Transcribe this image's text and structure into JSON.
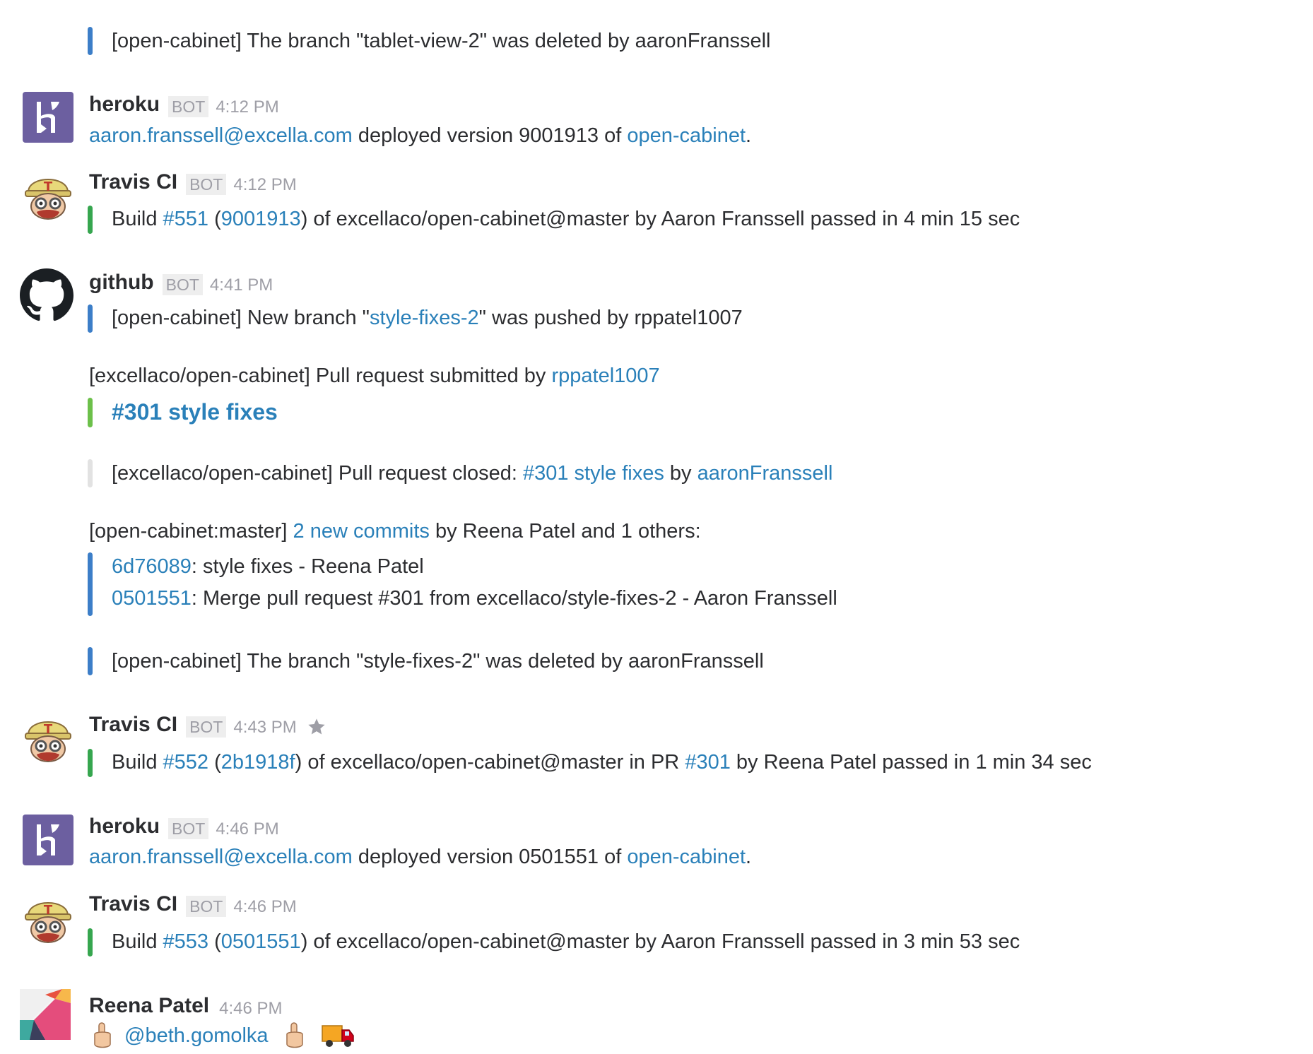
{
  "colors": {
    "link": "#2a80b9",
    "bar_blue": "#3c7ec8",
    "bar_green": "#36a64f",
    "bar_light_green": "#6cc04a",
    "bar_gray": "#e2e2e2",
    "heroku_purple": "#6c5fa0",
    "bot_badge_bg": "#eeeeee",
    "timestamp": "#9e9ea6"
  },
  "messages": [
    {
      "id": "m0",
      "attachment": {
        "prefix": "[open-cabinet] The branch \"tablet-view-2\" was deleted by aaronFranssell"
      }
    },
    {
      "id": "m1",
      "author": "heroku",
      "badge": "BOT",
      "time": "4:12 PM",
      "avatar_icon": "heroku-logo-icon",
      "email": "aaron.franssell@excella.com",
      "mid": " deployed version 9001913 of ",
      "app": "open-cabinet",
      "end": "."
    },
    {
      "id": "m2",
      "author": "Travis CI",
      "badge": "BOT",
      "time": "4:12 PM",
      "avatar_icon": "travis-mascot-icon",
      "t1": "Build ",
      "build": "#551",
      "t2": " (",
      "commit": "9001913",
      "t3": ") of excellaco/open-cabinet@master by Aaron Franssell passed in 4 min 15 sec"
    },
    {
      "id": "m3",
      "author": "github",
      "badge": "BOT",
      "time": "4:41 PM",
      "avatar_icon": "github-octocat-icon",
      "branch_pre": "[open-cabinet] New branch \"",
      "branch": "style-fixes-2",
      "branch_post": "\" was pushed by rppatel1007",
      "pr_pre": "[excellaco/open-cabinet] Pull request submitted by ",
      "pr_user": "rppatel1007",
      "pr_title": "#301 style fixes",
      "closed_pre": "[excellaco/open-cabinet] Pull request closed: ",
      "closed_link": "#301 style fixes",
      "closed_mid": " by ",
      "closed_user": "aaronFranssell",
      "commits_pre": "[open-cabinet:master] ",
      "commits_link": "2 new commits",
      "commits_post": " by Reena Patel and 1 others:",
      "commits": [
        {
          "sha": "6d76089",
          "msg": ": style fixes - Reena Patel"
        },
        {
          "sha": "0501551",
          "msg": ": Merge pull request #301 from excellaco/style-fixes-2 - Aaron Franssell"
        }
      ],
      "deleted": "[open-cabinet] The branch \"style-fixes-2\" was deleted by aaronFranssell"
    },
    {
      "id": "m4",
      "author": "Travis CI",
      "badge": "BOT",
      "time": "4:43 PM",
      "avatar_icon": "travis-mascot-icon",
      "t1": "Build ",
      "build": "#552",
      "t2": " (",
      "commit": "2b1918f",
      "t3": ") of excellaco/open-cabinet@master in PR ",
      "pr": "#301",
      "t4": " by Reena Patel passed in 1 min 34 sec"
    },
    {
      "id": "m5",
      "author": "heroku",
      "badge": "BOT",
      "time": "4:46 PM",
      "avatar_icon": "heroku-logo-icon",
      "email": "aaron.franssell@excella.com",
      "mid": " deployed version 0501551 of ",
      "app": "open-cabinet",
      "end": "."
    },
    {
      "id": "m6",
      "author": "Travis CI",
      "badge": "BOT",
      "time": "4:46 PM",
      "avatar_icon": "travis-mascot-icon",
      "t1": "Build ",
      "build": "#553",
      "t2": " (",
      "commit": "0501551",
      "t3": ") of excellaco/open-cabinet@master by Aaron Franssell passed in 3 min 53 sec"
    },
    {
      "id": "m7",
      "author": "Reena Patel",
      "time": "4:46 PM",
      "avatar_icon": "geometric-avatar-icon",
      "mention": "@beth.gomolka",
      "emojis": [
        "point-up-hand-icon",
        "point-up-hand-icon",
        "delivery-truck-icon"
      ]
    }
  ]
}
